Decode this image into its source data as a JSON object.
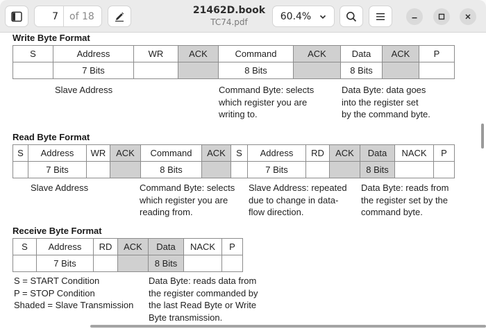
{
  "header": {
    "sidebar_icon": "sidebar-toggle-icon",
    "page_current": "7",
    "page_total_label": "of 18",
    "annotate_icon": "pencil-icon",
    "title": "21462D.book",
    "subtitle": "TC74.pdf",
    "zoom": "60.4%",
    "zoom_icon": "chevron-down-icon",
    "search_icon": "search-icon",
    "menu_icon": "hamburger-menu-icon",
    "minimize_icon": "minimize-icon",
    "maximize_icon": "maximize-icon",
    "close_icon": "close-icon"
  },
  "doc": {
    "write": {
      "title": "Write Byte Format",
      "row1": [
        "S",
        "Address",
        "WR",
        "ACK",
        "Command",
        "ACK",
        "Data",
        "ACK",
        "P"
      ],
      "row2": [
        "",
        "7 Bits",
        "",
        "",
        "8 Bits",
        "",
        "8 Bits",
        "",
        ""
      ],
      "shaded": [
        false,
        false,
        false,
        true,
        false,
        true,
        false,
        true,
        false
      ],
      "notes": [
        [
          "Slave Address"
        ],
        [
          "Command Byte: selects",
          "which register you are",
          "writing to."
        ],
        [
          "Data Byte: data goes",
          "into the register set",
          "by the command byte."
        ]
      ]
    },
    "read": {
      "title": "Read Byte Format",
      "row1": [
        "S",
        "Address",
        "WR",
        "ACK",
        "Command",
        "ACK",
        "S",
        "Address",
        "RD",
        "ACK",
        "Data",
        "NACK",
        "P"
      ],
      "row2": [
        "",
        "7 Bits",
        "",
        "",
        "8 Bits",
        "",
        "",
        "7 Bits",
        "",
        "",
        "8 Bits",
        "",
        ""
      ],
      "shaded": [
        false,
        false,
        false,
        true,
        false,
        true,
        false,
        false,
        false,
        true,
        true,
        false,
        false
      ],
      "notes": [
        [
          "Slave Address"
        ],
        [
          "Command Byte: selects",
          "which register you are",
          "reading from."
        ],
        [
          "Slave Address: repeated",
          "due to change in data-",
          "flow direction."
        ],
        [
          "Data Byte: reads from",
          "the register set by the",
          "command byte."
        ]
      ]
    },
    "receive": {
      "title": "Receive Byte Format",
      "row1": [
        "S",
        "Address",
        "RD",
        "ACK",
        "Data",
        "NACK",
        "P"
      ],
      "row2": [
        "",
        "7 Bits",
        "",
        "",
        "8 Bits",
        "",
        ""
      ],
      "shaded": [
        false,
        false,
        false,
        true,
        true,
        false,
        false
      ],
      "legend": [
        "S = START Condition",
        "P = STOP Condition",
        "Shaded = Slave Transmission"
      ],
      "note": [
        "Data Byte: reads data from",
        "the register commanded by",
        "the last Read Byte or Write",
        "Byte transmission."
      ]
    }
  }
}
